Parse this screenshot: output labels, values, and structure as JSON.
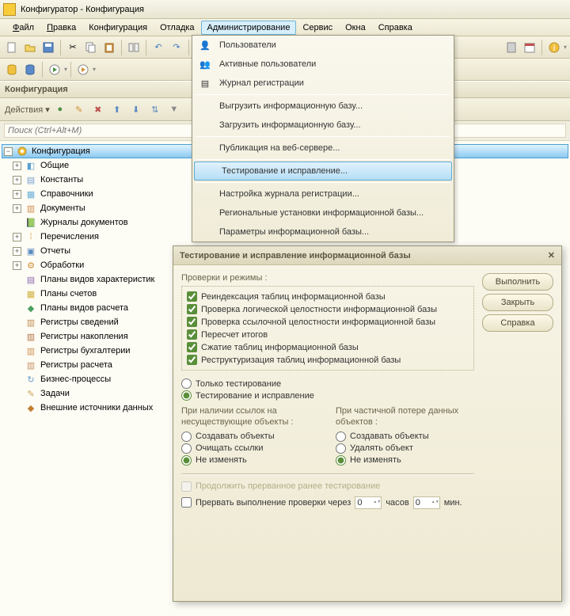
{
  "title": "Конфигуратор - Конфигурация",
  "menu": {
    "file": "Файл",
    "edit": "Правка",
    "config": "Конфигурация",
    "debug": "Отладка",
    "admin": "Администрирование",
    "service": "Сервис",
    "windows": "Окна",
    "help": "Справка"
  },
  "panel": {
    "title": "Конфигурация",
    "actions": "Действия ▾",
    "search_ph": "Поиск (Ctrl+Alt+M)"
  },
  "tree": {
    "root": "Конфигурация",
    "items": [
      {
        "l": "Общие",
        "i": "◧",
        "c": "#5aa0d0",
        "e": "+"
      },
      {
        "l": "Константы",
        "i": "▤",
        "c": "#7aa0d0",
        "e": "+"
      },
      {
        "l": "Справочники",
        "i": "▦",
        "c": "#6aafd8",
        "e": "+"
      },
      {
        "l": "Документы",
        "i": "▥",
        "c": "#d08a4a",
        "e": "+"
      },
      {
        "l": "Журналы документов",
        "i": "📗",
        "c": "#4a9a5a",
        "e": ""
      },
      {
        "l": "Перечисления",
        "i": "⁞",
        "c": "#d8a040",
        "e": "+"
      },
      {
        "l": "Отчеты",
        "i": "▣",
        "c": "#5a8ac0",
        "e": "+"
      },
      {
        "l": "Обработки",
        "i": "⚙",
        "c": "#d09030",
        "e": "+"
      },
      {
        "l": "Планы видов характеристик",
        "i": "▤",
        "c": "#8a6ab0",
        "e": ""
      },
      {
        "l": "Планы счетов",
        "i": "▦",
        "c": "#d0b040",
        "e": ""
      },
      {
        "l": "Планы видов расчета",
        "i": "◆",
        "c": "#4aa060",
        "e": ""
      },
      {
        "l": "Регистры сведений",
        "i": "▥",
        "c": "#c08a50",
        "e": ""
      },
      {
        "l": "Регистры накопления",
        "i": "▥",
        "c": "#b07040",
        "e": ""
      },
      {
        "l": "Регистры бухгалтерии",
        "i": "▥",
        "c": "#d09050",
        "e": ""
      },
      {
        "l": "Регистры расчета",
        "i": "▥",
        "c": "#c89060",
        "e": ""
      },
      {
        "l": "Бизнес-процессы",
        "i": "↻",
        "c": "#6a9ad0",
        "e": ""
      },
      {
        "l": "Задачи",
        "i": "✎",
        "c": "#d0a050",
        "e": ""
      },
      {
        "l": "Внешние источники данных",
        "i": "◆",
        "c": "#c08030",
        "e": ""
      }
    ]
  },
  "dropdown": [
    {
      "t": "Пользователи",
      "i": "👤"
    },
    {
      "t": "Активные пользователи",
      "i": "👥"
    },
    {
      "t": "Журнал регистрации",
      "i": "▤"
    },
    {
      "sep": true
    },
    {
      "t": "Выгрузить информационную базу..."
    },
    {
      "t": "Загрузить информационную базу..."
    },
    {
      "sep": true
    },
    {
      "t": "Публикация на веб-сервере..."
    },
    {
      "sep": true
    },
    {
      "t": "Тестирование и исправление...",
      "hl": true
    },
    {
      "sep": true
    },
    {
      "t": "Настройка журнала регистрации..."
    },
    {
      "t": "Региональные установки информационной базы..."
    },
    {
      "t": "Параметры информационной базы..."
    }
  ],
  "dlg": {
    "title": "Тестирование и исправление информационной базы",
    "btn_run": "Выполнить",
    "btn_close": "Закрыть",
    "btn_help": "Справка",
    "modes_label": "Проверки и режимы :",
    "checks": [
      "Реиндексация таблиц информационной базы",
      "Проверка логической целостности информационной базы",
      "Проверка ссылочной целостности информационной базы",
      "Пересчет итогов",
      "Сжатие таблиц информационной базы",
      "Реструктуризация таблиц информационной базы"
    ],
    "r_test": "Только тестирование",
    "r_fix": "Тестирование и исправление",
    "col1_h": "При наличии ссылок на несуществующие объекты :",
    "col2_h": "При частичной потере данных объектов :",
    "c1": [
      "Создавать объекты",
      "Очищать ссылки",
      "Не изменять"
    ],
    "c2": [
      "Создавать объекты",
      "Удалять объект",
      "Не изменять"
    ],
    "cont": "Продолжить прерванное ранее тестирование",
    "abort": "Прервать выполнение проверки через",
    "hours": "часов",
    "mins": "мин.",
    "zero": "0"
  }
}
